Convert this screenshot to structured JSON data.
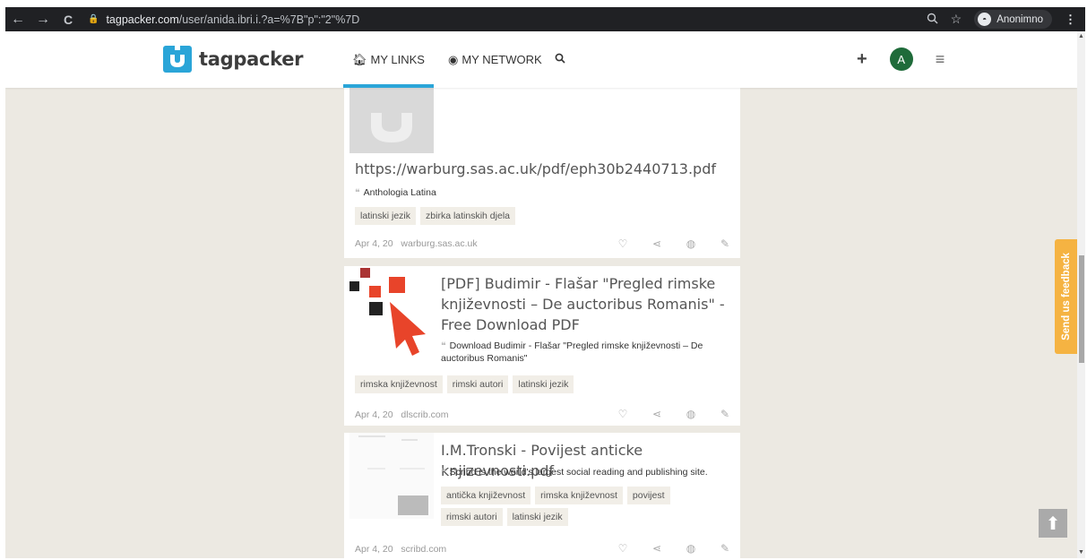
{
  "browser": {
    "back": "←",
    "forward": "→",
    "reload": "C",
    "url_host": "tagpacker.com",
    "url_path": "/user/anida.ibri.i.?a=%7B\"p\":\"2\"%7D",
    "zoom_icon": "zoom-icon",
    "star_icon": "star-icon",
    "profile_label": "Anonimno",
    "menu_icon": "⋮"
  },
  "header": {
    "logo_text": "tagpacker",
    "nav": [
      {
        "label": "MY LINKS",
        "icon": "home-icon",
        "active": true
      },
      {
        "label": "MY NETWORK",
        "icon": "globe-icon",
        "active": false
      }
    ],
    "avatar_letter": "A",
    "accent": "#2aa5d8"
  },
  "links": [
    {
      "title": "https://warburg.sas.ac.uk/pdf/eph30b2440713.pdf",
      "description": "Anthologia Latina",
      "tags": [
        "latinski jezik",
        "zbirka latinskih djela"
      ],
      "date": "Apr 4, 20",
      "domain": "warburg.sas.ac.uk"
    },
    {
      "title": "[PDF] Budimir - Flašar \"Pregled rimske književnosti – De auctoribus Romanis\" - Free Download PDF",
      "description": "Download Budimir - Flašar \"Pregled rimske književnosti – De auctoribus Romanis\"",
      "tags": [
        "rimska književnost",
        "rimski autori",
        "latinski jezik"
      ],
      "date": "Apr 4, 20",
      "domain": "dlscrib.com"
    },
    {
      "title": "I.M.Tronski - Povijest anticke knjizevnosti.pdf",
      "description": "Scribd is the world's largest social reading and publishing site.",
      "tags": [
        "antička književnost",
        "rimska književnost",
        "povijest",
        "rimski autori",
        "latinski jezik"
      ],
      "date": "Apr 4, 20",
      "domain": "scribd.com"
    }
  ],
  "feedback_label": "Send us feedback",
  "to_top_icon": "arrow-up-icon"
}
